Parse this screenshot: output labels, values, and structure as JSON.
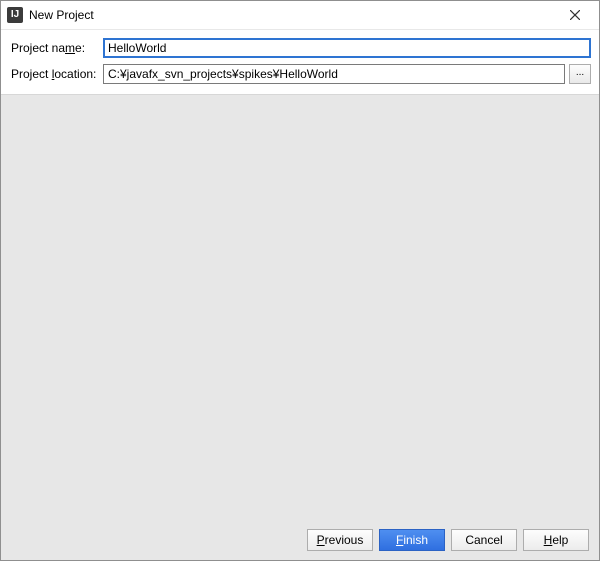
{
  "window": {
    "title": "New Project"
  },
  "form": {
    "name_label_pre": "Project na",
    "name_label_mn": "m",
    "name_label_post": "e:",
    "name_value": "HelloWorld",
    "location_label_pre": "Project ",
    "location_label_mn": "l",
    "location_label_post": "ocation:",
    "location_value": "C:¥javafx_svn_projects¥spikes¥HelloWorld",
    "browse_label": "..."
  },
  "buttons": {
    "previous_mn": "P",
    "previous_rest": "revious",
    "finish_mn": "F",
    "finish_rest": "inish",
    "cancel": "Cancel",
    "help_mn": "H",
    "help_rest": "elp"
  }
}
